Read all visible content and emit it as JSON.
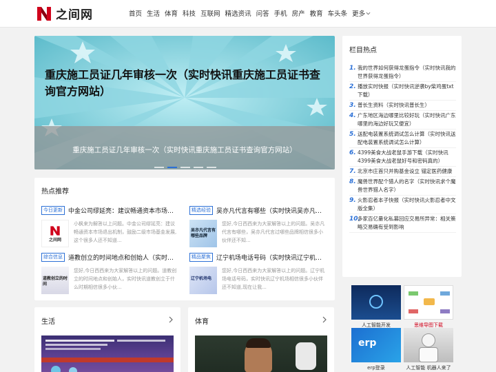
{
  "site": {
    "logo_text": "之间网"
  },
  "nav": {
    "items": [
      "首页",
      "生活",
      "体育",
      "科技",
      "互联网",
      "精选资讯",
      "问答",
      "手机",
      "房产",
      "教育",
      "车头条"
    ],
    "more_label": "更多"
  },
  "hero": {
    "title": "重庆施工员证几年审核一次（实时快讯重庆施工员证书查询官方网站）",
    "caption": "重庆施工员证几年审核一次（实时快讯重庆施工员证书查询官方网站）",
    "slide_count": 5,
    "active_slide": 2
  },
  "featured": {
    "heading": "热点推荐",
    "items": [
      {
        "tag": "今日更新",
        "title": "中金公司缪延亮：建议畅通资本市场退出机...",
        "desc": "小枫来为解答以上问题。中金公司缪延亮：建议畅通资本市场退出机制，鼓励二级市场基金发展,这个很多人还不知道...",
        "thumb_text": "之间网"
      },
      {
        "tag": "精选经验",
        "title": "吴亦凡代言有哪些（实时快讯吴亦凡代言过...",
        "desc": "您好,今日西西来为大家解答以上的问题。吴亦凡代言有哪些，吴亦凡代言过哪些品牌相信很多小伙伴还不知...",
        "thumb_text": "吴亦凡代言有哪些品牌"
      },
      {
        "tag": "综合信息",
        "title": "道教创立的时间地点和创始人（实时快讯道...",
        "desc": "您好,今日西西来为大家解答以上的问题。道教创立的时间地点和创始人，实时快讯道教创立于什么时期相信很多小伙...",
        "thumb_text": "道教创立的时间"
      },
      {
        "tag": "精品聚焦",
        "title": "辽宁机场电话号码（实时快讯辽宁机场）",
        "desc": "您好,今日西西来为大家解答以上的问题。辽宁机场电话号码，实时快讯辽宁机场相信很多小伙伴还不知道,现在让我...",
        "thumb_text": "辽宁机场电"
      }
    ]
  },
  "categories": [
    {
      "title": "生活"
    },
    {
      "title": "体育"
    }
  ],
  "hotlist": {
    "heading": "栏目热点",
    "items": [
      {
        "num": "1.",
        "text": "我的世界如何获得龙蛋指令（实时快讯我的世界获得龙蛋指令）"
      },
      {
        "num": "2.",
        "text": "播放实时快报（实时快讯逆袭by柴鸡蛋txt下载）"
      },
      {
        "num": "3.",
        "text": "普长生资料（实时快讯普长生）"
      },
      {
        "num": "4.",
        "text": "广东地区海边哪里比较好玩（实时快讯广东哪里的海边好玩又便宜）"
      },
      {
        "num": "5.",
        "text": "送配电装置系统调试怎么计算（实时快讯送配电装置系统调试怎么计算）"
      },
      {
        "num": "6.",
        "text": "4399美食大战老鼠手游下载（实时快讯4399美食大战老鼠好号和密码真的）"
      },
      {
        "num": "7.",
        "text": "北京市庄首只并购基金设立 锚定医药健康"
      },
      {
        "num": "8.",
        "text": "魔兽世界配个猎人的名字（实时快讯求个魔兽世界猎人名字）"
      },
      {
        "num": "9.",
        "text": "火影忍者本子快报（实时快讯火影忍者中文版全集）"
      },
      {
        "num": "10.",
        "text": "多家百亿量化私募回应交易所异常：相关策略交易确有受到影响"
      }
    ]
  },
  "gallery": [
    {
      "caption": "人工智能开发"
    },
    {
      "caption": "思维导图下载"
    },
    {
      "caption": "erp登录"
    },
    {
      "caption": "人工智能 机器人来了"
    }
  ],
  "colors": {
    "accent": "#2a6fd6",
    "logo_red": "#d0021b",
    "bg": "#f2f2f2"
  }
}
